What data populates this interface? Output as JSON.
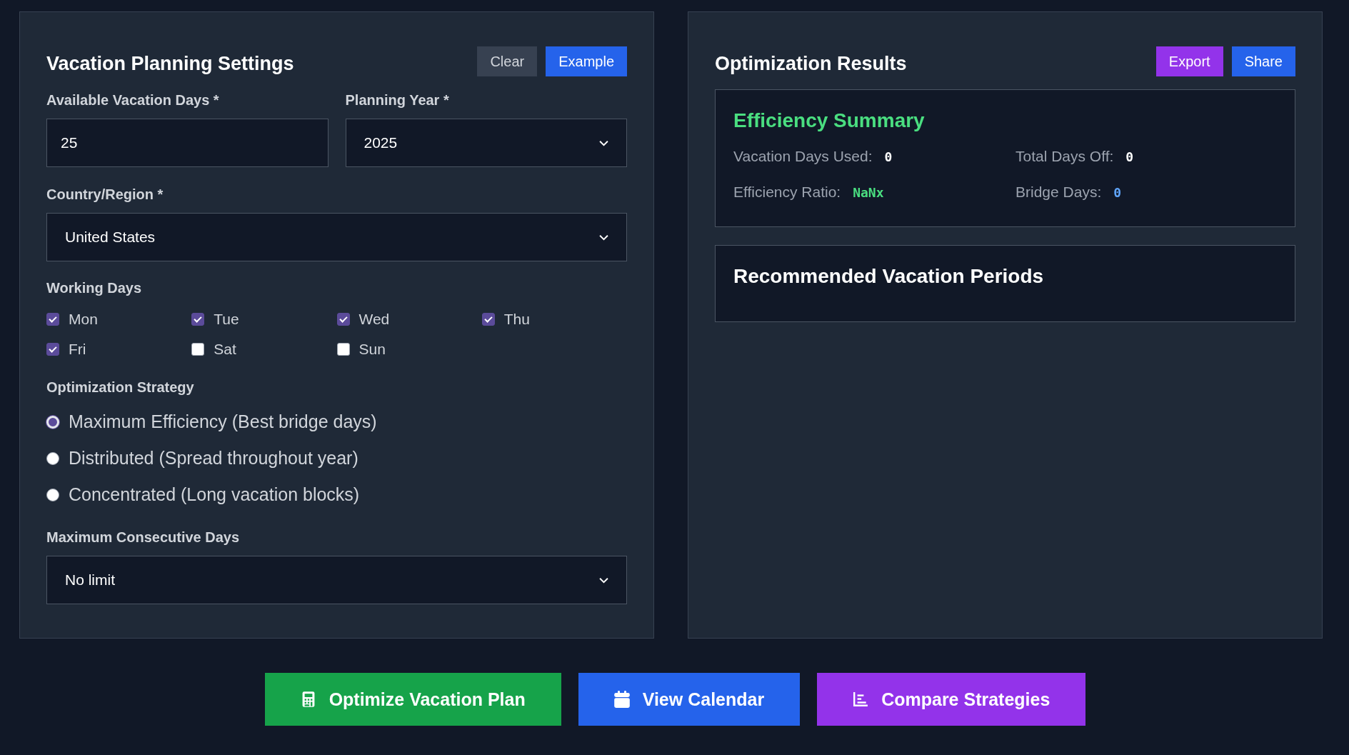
{
  "settings": {
    "title": "Vacation Planning Settings",
    "buttons": [
      {
        "label": "Clear",
        "kind": "secondary"
      },
      {
        "label": "Example",
        "kind": "primary"
      }
    ],
    "vacation_days": {
      "label": "Available Vacation Days *",
      "value": "25"
    },
    "planning_year": {
      "label": "Planning Year *",
      "value": "2025"
    },
    "country": {
      "label": "Country/Region *",
      "value": "United States"
    },
    "working_days": {
      "label": "Working Days",
      "days": [
        {
          "label": "Mon",
          "checked": true
        },
        {
          "label": "Tue",
          "checked": true
        },
        {
          "label": "Wed",
          "checked": true
        },
        {
          "label": "Thu",
          "checked": true
        },
        {
          "label": "Fri",
          "checked": true
        },
        {
          "label": "Sat",
          "checked": false
        },
        {
          "label": "Sun",
          "checked": false
        }
      ]
    },
    "strategy": {
      "label": "Optimization Strategy",
      "options": [
        {
          "label": "Maximum Efficiency (Best bridge days)",
          "selected": true
        },
        {
          "label": "Distributed (Spread throughout year)",
          "selected": false
        },
        {
          "label": "Concentrated (Long vacation blocks)",
          "selected": false
        }
      ]
    },
    "max_consecutive": {
      "label": "Maximum Consecutive Days",
      "value": "No limit"
    }
  },
  "results": {
    "title": "Optimization Results",
    "buttons": [
      {
        "label": "Export",
        "kind": "purple"
      },
      {
        "label": "Share",
        "kind": "primary"
      }
    ],
    "summary": {
      "title": "Efficiency Summary",
      "stats": [
        {
          "label": "Vacation Days Used:",
          "value": "0",
          "color": "#ffffff"
        },
        {
          "label": "Total Days Off:",
          "value": "0",
          "color": "#ffffff"
        },
        {
          "label": "Efficiency Ratio:",
          "value": "NaNx",
          "color": "#4ade80"
        },
        {
          "label": "Bridge Days:",
          "value": "0",
          "color": "#60a5fa"
        }
      ]
    },
    "periods": {
      "title": "Recommended Vacation Periods"
    }
  },
  "actions": [
    {
      "label": "Optimize Vacation Plan",
      "kind": "green"
    },
    {
      "label": "View Calendar",
      "kind": "primary"
    },
    {
      "label": "Compare Strategies",
      "kind": "purple"
    }
  ]
}
